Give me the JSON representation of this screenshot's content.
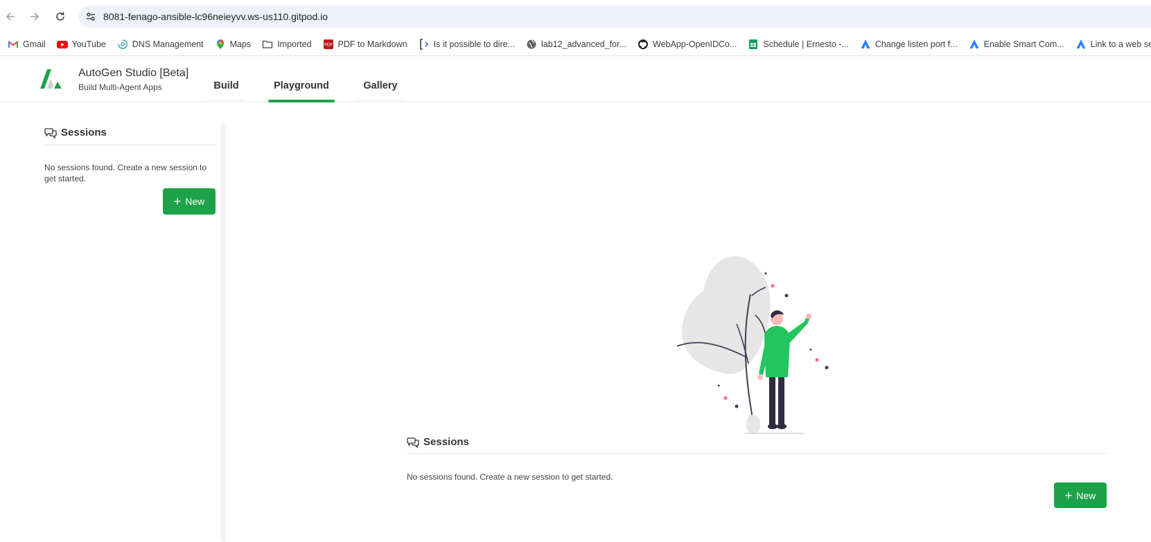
{
  "browser": {
    "url": "8081-fenago-ansible-lc96neieyvv.ws-us110.gitpod.io",
    "bookmarks": [
      {
        "label": "Gmail",
        "icon": "gmail-icon"
      },
      {
        "label": "YouTube",
        "icon": "youtube-icon"
      },
      {
        "label": "DNS Management",
        "icon": "dns-icon"
      },
      {
        "label": "Maps",
        "icon": "maps-icon"
      },
      {
        "label": "Imported",
        "icon": "folder-icon"
      },
      {
        "label": "PDF to Markdown",
        "icon": "pdf-icon"
      },
      {
        "label": "Is it possible to dire...",
        "icon": "bracket-icon"
      },
      {
        "label": "lab12_advanced_for...",
        "icon": "globe-icon"
      },
      {
        "label": "WebApp-OpenIDCo...",
        "icon": "github-icon"
      },
      {
        "label": "Schedule | Ernesto -...",
        "icon": "sheets-icon"
      },
      {
        "label": "Change listen port f...",
        "icon": "atlassian-icon"
      },
      {
        "label": "Enable Smart Com...",
        "icon": "atlassian-icon"
      },
      {
        "label": "Link to a web servic...",
        "icon": "atlassian-icon"
      }
    ]
  },
  "app": {
    "title": "AutoGen Studio [Beta]",
    "subtitle": "Build Multi-Agent Apps",
    "tabs": [
      {
        "label": "Build",
        "active": false
      },
      {
        "label": "Playground",
        "active": true
      },
      {
        "label": "Gallery",
        "active": false
      }
    ],
    "accent_color": "#1da249"
  },
  "sidebar": {
    "title": "Sessions",
    "empty_text": "No sessions found. Create a new session to get started.",
    "new_button": "New"
  },
  "main": {
    "title": "Sessions",
    "empty_text": "No sessions found. Create a new session to get started.",
    "new_button": "New"
  }
}
